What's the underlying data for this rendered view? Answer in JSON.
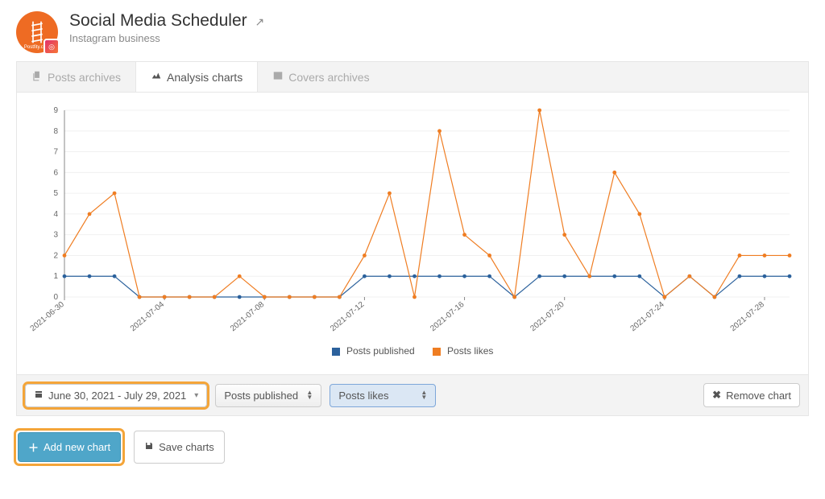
{
  "header": {
    "title": "Social Media Scheduler",
    "subtitle": "Instagram business",
    "logo_text": "Postfity.com"
  },
  "tabs": {
    "posts_archives": "Posts archives",
    "analysis_charts": "Analysis charts",
    "covers_archives": "Covers archives"
  },
  "controls": {
    "date_range": "June 30, 2021 - July 29, 2021",
    "metric_a": "Posts published",
    "metric_b": "Posts likes",
    "remove_chart": "Remove chart"
  },
  "buttons": {
    "add_new_chart": "Add new chart",
    "save_charts": "Save charts"
  },
  "legend": {
    "posts_published": "Posts published",
    "posts_likes": "Posts likes"
  },
  "chart_data": {
    "type": "line",
    "categories": [
      "2021-06-30",
      "2021-07-01",
      "2021-07-02",
      "2021-07-03",
      "2021-07-04",
      "2021-07-05",
      "2021-07-06",
      "2021-07-07",
      "2021-07-08",
      "2021-07-09",
      "2021-07-10",
      "2021-07-11",
      "2021-07-12",
      "2021-07-13",
      "2021-07-14",
      "2021-07-15",
      "2021-07-16",
      "2021-07-17",
      "2021-07-18",
      "2021-07-19",
      "2021-07-20",
      "2021-07-21",
      "2021-07-22",
      "2021-07-23",
      "2021-07-24",
      "2021-07-25",
      "2021-07-26",
      "2021-07-27",
      "2021-07-28",
      "2021-07-29"
    ],
    "x_tick_labels": [
      "2021-06-30",
      "2021-07-04",
      "2021-07-08",
      "2021-07-12",
      "2021-07-16",
      "2021-07-20",
      "2021-07-24",
      "2021-07-28"
    ],
    "series": [
      {
        "name": "Posts published",
        "color": "#2b619c",
        "values": [
          1,
          1,
          1,
          0,
          0,
          0,
          0,
          0,
          0,
          0,
          0,
          0,
          1,
          1,
          1,
          1,
          1,
          1,
          0,
          1,
          1,
          1,
          1,
          1,
          0,
          1,
          0,
          1,
          1,
          1
        ]
      },
      {
        "name": "Posts likes",
        "color": "#ef7d22",
        "values": [
          2,
          4,
          5,
          0,
          0,
          0,
          0,
          1,
          0,
          0,
          0,
          0,
          2,
          5,
          0,
          8,
          3,
          2,
          0,
          9,
          3,
          1,
          6,
          4,
          0,
          1,
          0,
          2,
          2,
          2
        ]
      }
    ],
    "ylabel": "",
    "xlabel": "",
    "ylim": [
      0,
      9
    ],
    "y_ticks": [
      0,
      1,
      2,
      3,
      4,
      5,
      6,
      7,
      8,
      9
    ]
  }
}
